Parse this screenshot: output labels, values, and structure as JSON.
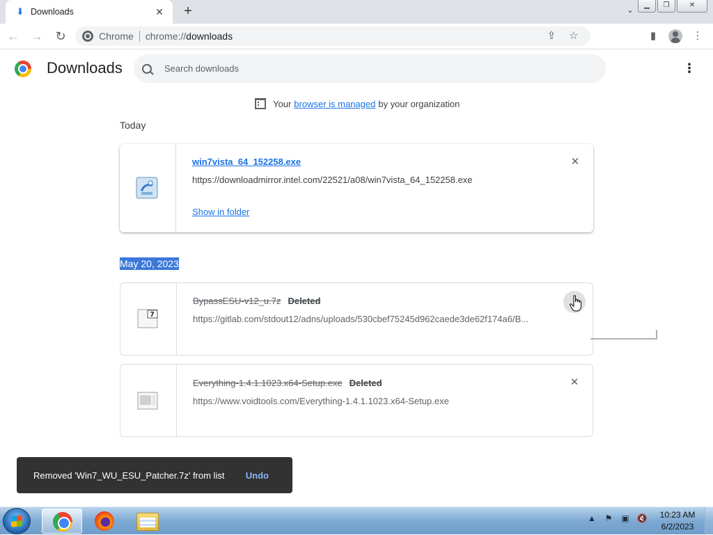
{
  "tab": {
    "title": "Downloads",
    "close": "✕",
    "new_tab": "+",
    "tab_search": "⌄"
  },
  "window": {
    "minimize": "▁",
    "restore": "❐",
    "close": "✕"
  },
  "toolbar": {
    "back": "←",
    "forward": "→",
    "reload": "↻",
    "site_chip": "Chrome",
    "url_scheme": "chrome://",
    "url_host": "downloads",
    "share": "⇪",
    "bookmark": "☆",
    "side_panel": "▮",
    "menu": "⋮"
  },
  "page": {
    "title": "Downloads",
    "search_placeholder": "Search downloads",
    "menu": "⋮"
  },
  "managed": {
    "prefix": "Your",
    "link": "browser is managed",
    "suffix": "by your organization"
  },
  "sections": {
    "today": "Today",
    "may": "May 20, 2023"
  },
  "downloads": [
    {
      "name": "win7vista_64_152258.exe",
      "url": "https://downloadmirror.intel.com/22521/a08/win7vista_64_152258.exe",
      "action": "Show in folder",
      "remove": "✕"
    },
    {
      "name": "BypassESU-v12_u.7z",
      "status": "Deleted",
      "url": "https://gitlab.com/stdout12/adns/uploads/530cbef75245d962caede3de62f174a6/B...",
      "remove": "✕"
    },
    {
      "name": "Everything-1.4.1.1023.x64-Setup.exe",
      "status": "Deleted",
      "url": "https://www.voidtools.com/Everything-1.4.1.1023.x64-Setup.exe",
      "remove": "✕"
    }
  ],
  "toast": {
    "message": "Removed 'Win7_WU_ESU_Patcher.7z' from list",
    "undo": "Undo"
  },
  "taskbar": {
    "tray_arrow": "▲",
    "time": "10:23 AM",
    "date": "6/2/2023"
  },
  "colors": {
    "accent": "#1a73e8",
    "selection": "#3b78d8",
    "toast_bg": "#323232",
    "toast_link": "#8ab4f8"
  }
}
